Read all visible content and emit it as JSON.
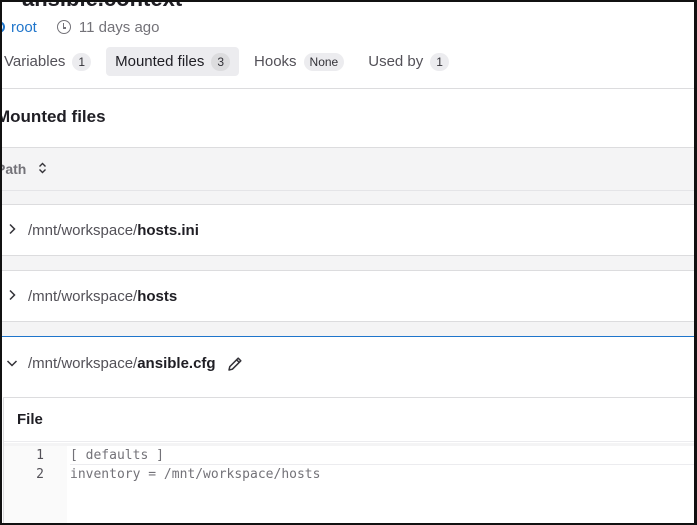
{
  "header": {
    "title": "ansible.context",
    "owner": "root",
    "age": "11 days ago"
  },
  "tabs": [
    {
      "label": "Variables",
      "count": "1"
    },
    {
      "label": "Mounted files",
      "count": "3"
    },
    {
      "label": "Hooks",
      "count": "None"
    },
    {
      "label": "Used by",
      "count": "1"
    }
  ],
  "section": {
    "title": "Mounted files"
  },
  "table": {
    "column": "Path"
  },
  "files": [
    {
      "prefix": "/mnt/workspace/",
      "name": "hosts.ini"
    },
    {
      "prefix": "/mnt/workspace/",
      "name": "hosts"
    },
    {
      "prefix": "/mnt/workspace/",
      "name": "ansible.cfg"
    }
  ],
  "file_panel": {
    "title": "File",
    "lines": [
      {
        "no": "1",
        "text": "[ defaults ]"
      },
      {
        "no": "2",
        "text": "inventory = /mnt/workspace/hosts"
      }
    ]
  },
  "icons": {
    "owner": "user-icon",
    "time": "clock-icon",
    "collapsed": "chevron-right-icon",
    "expanded": "chevron-down-icon",
    "edit": "pencil-icon",
    "sort": "sort-icon"
  },
  "colors": {
    "link": "#1f75cb",
    "active_border": "#1f75cb"
  }
}
